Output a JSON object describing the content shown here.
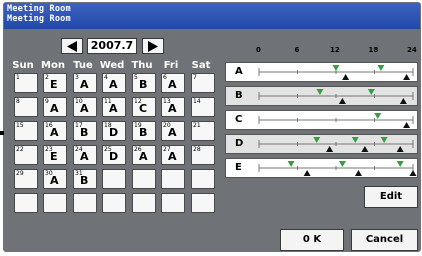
{
  "window": {
    "title_line1": "Meeting Room",
    "title_line2": "Meeting Room"
  },
  "calendar": {
    "month": "2007.7",
    "weekdays": [
      "Sun",
      "Mon",
      "Tue",
      "Wed",
      "Thu",
      "Fri",
      "Sat"
    ],
    "weeks": [
      [
        {
          "day": "1",
          "sched": ""
        },
        {
          "day": "2",
          "sched": "E"
        },
        {
          "day": "3",
          "sched": "A"
        },
        {
          "day": "4",
          "sched": "A"
        },
        {
          "day": "5",
          "sched": "B"
        },
        {
          "day": "6",
          "sched": "A"
        },
        {
          "day": "7",
          "sched": ""
        }
      ],
      [
        {
          "day": "8",
          "sched": ""
        },
        {
          "day": "9",
          "sched": "A"
        },
        {
          "day": "10",
          "sched": "A"
        },
        {
          "day": "11",
          "sched": "A"
        },
        {
          "day": "12",
          "sched": "C"
        },
        {
          "day": "13",
          "sched": "A"
        },
        {
          "day": "14",
          "sched": ""
        }
      ],
      [
        {
          "day": "15",
          "sched": ""
        },
        {
          "day": "16",
          "sched": "A"
        },
        {
          "day": "17",
          "sched": "B"
        },
        {
          "day": "18",
          "sched": "D"
        },
        {
          "day": "19",
          "sched": "B"
        },
        {
          "day": "20",
          "sched": "A"
        },
        {
          "day": "21",
          "sched": ""
        }
      ],
      [
        {
          "day": "22",
          "sched": ""
        },
        {
          "day": "23",
          "sched": "E"
        },
        {
          "day": "24",
          "sched": "A"
        },
        {
          "day": "25",
          "sched": "D"
        },
        {
          "day": "26",
          "sched": "A"
        },
        {
          "day": "27",
          "sched": "A"
        },
        {
          "day": "28",
          "sched": ""
        }
      ],
      [
        {
          "day": "29",
          "sched": ""
        },
        {
          "day": "30",
          "sched": "A"
        },
        {
          "day": "31",
          "sched": "B"
        },
        {
          "day": "",
          "sched": ""
        },
        {
          "day": "",
          "sched": ""
        },
        {
          "day": "",
          "sched": ""
        },
        {
          "day": "",
          "sched": ""
        }
      ],
      [
        {
          "day": "",
          "sched": ""
        },
        {
          "day": "",
          "sched": ""
        },
        {
          "day": "",
          "sched": ""
        },
        {
          "day": "",
          "sched": ""
        },
        {
          "day": "",
          "sched": ""
        },
        {
          "day": "",
          "sched": ""
        },
        {
          "day": "",
          "sched": ""
        }
      ]
    ]
  },
  "schedule": {
    "hour_labels": [
      "0",
      "6",
      "12",
      "18",
      "24"
    ],
    "colors": {
      "on_marker": "#3c9a45",
      "off_marker": "#111111"
    },
    "patterns": [
      {
        "label": "A",
        "on_times": [
          12,
          19
        ],
        "off_times": [
          13.5,
          23
        ]
      },
      {
        "label": "B",
        "on_times": [
          9.5,
          17.5
        ],
        "off_times": [
          13,
          22.5
        ]
      },
      {
        "label": "C",
        "on_times": [
          18.5
        ],
        "off_times": [
          23
        ]
      },
      {
        "label": "D",
        "on_times": [
          9,
          15,
          19.5
        ],
        "off_times": [
          11,
          16.5,
          22
        ]
      },
      {
        "label": "E",
        "on_times": [
          5,
          13,
          22
        ],
        "off_times": [
          7.5,
          15.5,
          24
        ]
      }
    ]
  },
  "buttons": {
    "edit": "Edit",
    "ok": "0 K",
    "cancel": "Cancel"
  }
}
